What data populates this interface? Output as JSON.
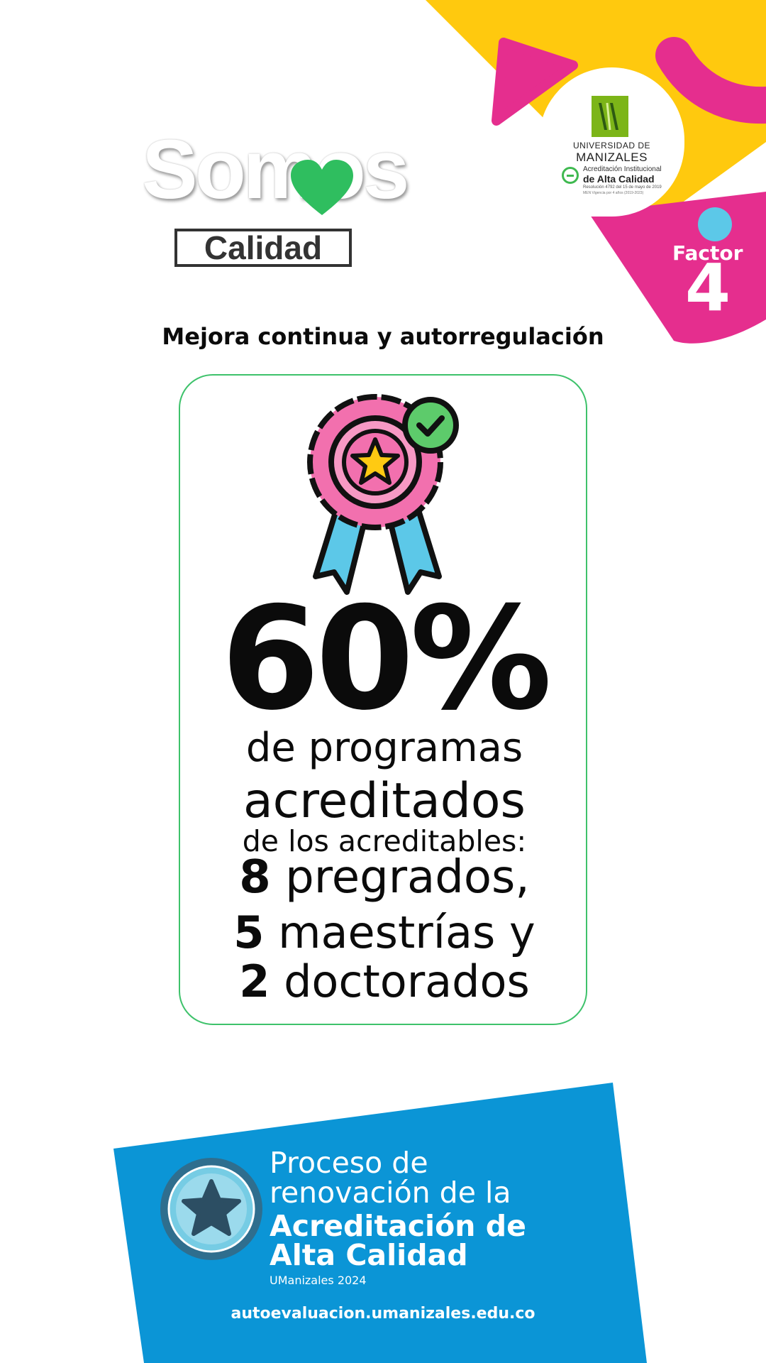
{
  "brand": {
    "word": "Somos",
    "subtitle": "Calidad"
  },
  "logo": {
    "name_line1": "UNIVERSIDAD DE",
    "name_line2": "MANIZALES",
    "accreditation_line1": "Acreditación Institucional",
    "accreditation_line2": "de Alta Calidad",
    "accreditation_line3": "Resolución 4792 del 15 de mayo de 2019",
    "accreditation_line4": "MEN Vigencia por 4 años (2019-2023)"
  },
  "factor": {
    "label": "Factor",
    "number": "4"
  },
  "title": "Mejora continua y autorregulación",
  "stat": {
    "percent": "60%",
    "line1": "de programas",
    "line2": "acreditados",
    "line3": "de los acreditables:",
    "pregrados_count": "8",
    "pregrados_label": "pregrados,",
    "maestrias_count": "5",
    "maestrias_label": "maestrías y",
    "doctorados_count": "2",
    "doctorados_label": "doctorados"
  },
  "banner": {
    "line1": "Proceso de",
    "line2": "renovación de la",
    "line3": "Acreditación de",
    "line4": "Alta Calidad",
    "line5": "UManizales 2024",
    "url": "autoevaluacion.umanizales.edu.co"
  },
  "icons": [
    "award-ribbon-icon",
    "check-badge-icon",
    "star-seal-icon",
    "heart-icon"
  ],
  "colors": {
    "yellow": "#FFC90E",
    "magenta": "#E52E8E",
    "light_blue": "#5CC8E8",
    "green": "#3EC26B",
    "banner_blue": "#0B95D6",
    "text": "#0B0B0B"
  }
}
